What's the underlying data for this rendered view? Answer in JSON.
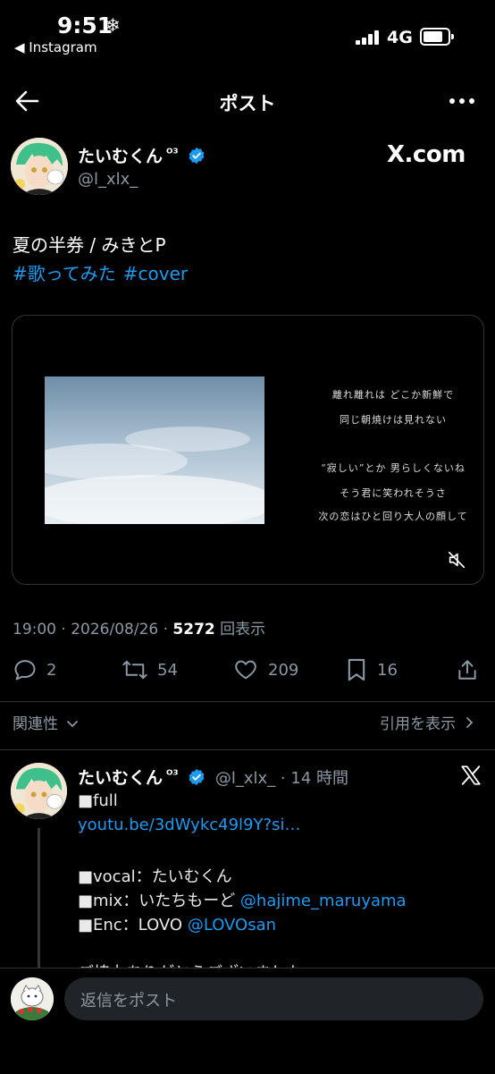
{
  "status_bar": {
    "time": "9:51",
    "weather_icon": "snowflake-icon",
    "back_app": "◀ Instagram",
    "network": "4G"
  },
  "nav": {
    "title": "ポスト"
  },
  "post": {
    "author_name": "たいむくん",
    "author_badge": "ᴼ³",
    "handle": "@l_xlx_",
    "site_label": "X.com",
    "text": "夏の半券 / みきとP",
    "hashtags": [
      "#歌ってみた",
      "#cover"
    ],
    "video_lyrics": [
      "離れ離れは どこか新鮮で",
      "同じ朝焼けは見れない",
      "“寂しい”とか 男らしくないね",
      "そう君に笑われそうさ",
      "次の恋はひと回り大人の顔して"
    ],
    "time": "19:00",
    "date": "2026/08/26",
    "views": "5272",
    "views_label": "回表示",
    "replies": "2",
    "reposts": "54",
    "likes": "209",
    "bookmarks": "16"
  },
  "filters": {
    "left": "関連性",
    "right": "引用を表示"
  },
  "reply": {
    "author_name": "たいむくん",
    "author_badge": "ᴼ³",
    "handle": "@l_xlx_",
    "age": "14 時間",
    "line1": "■full",
    "link1": "youtu.be/3dWykc49l9Y?si…",
    "vocal": "■vocal：たいむくん",
    "mix_prefix": "■mix：いたちもーど ",
    "mix_link": "@hajime_maruyama",
    "enc_prefix": "■Enc：LOVO ",
    "enc_link": "@LOVOsan",
    "cut_line": "ご協力ありがとうございました"
  },
  "composer": {
    "placeholder": "返信をポスト"
  },
  "colors": {
    "accent": "#1d9bf0",
    "background": "#000000",
    "muted": "#8b98a5",
    "divider": "#2f3336"
  }
}
